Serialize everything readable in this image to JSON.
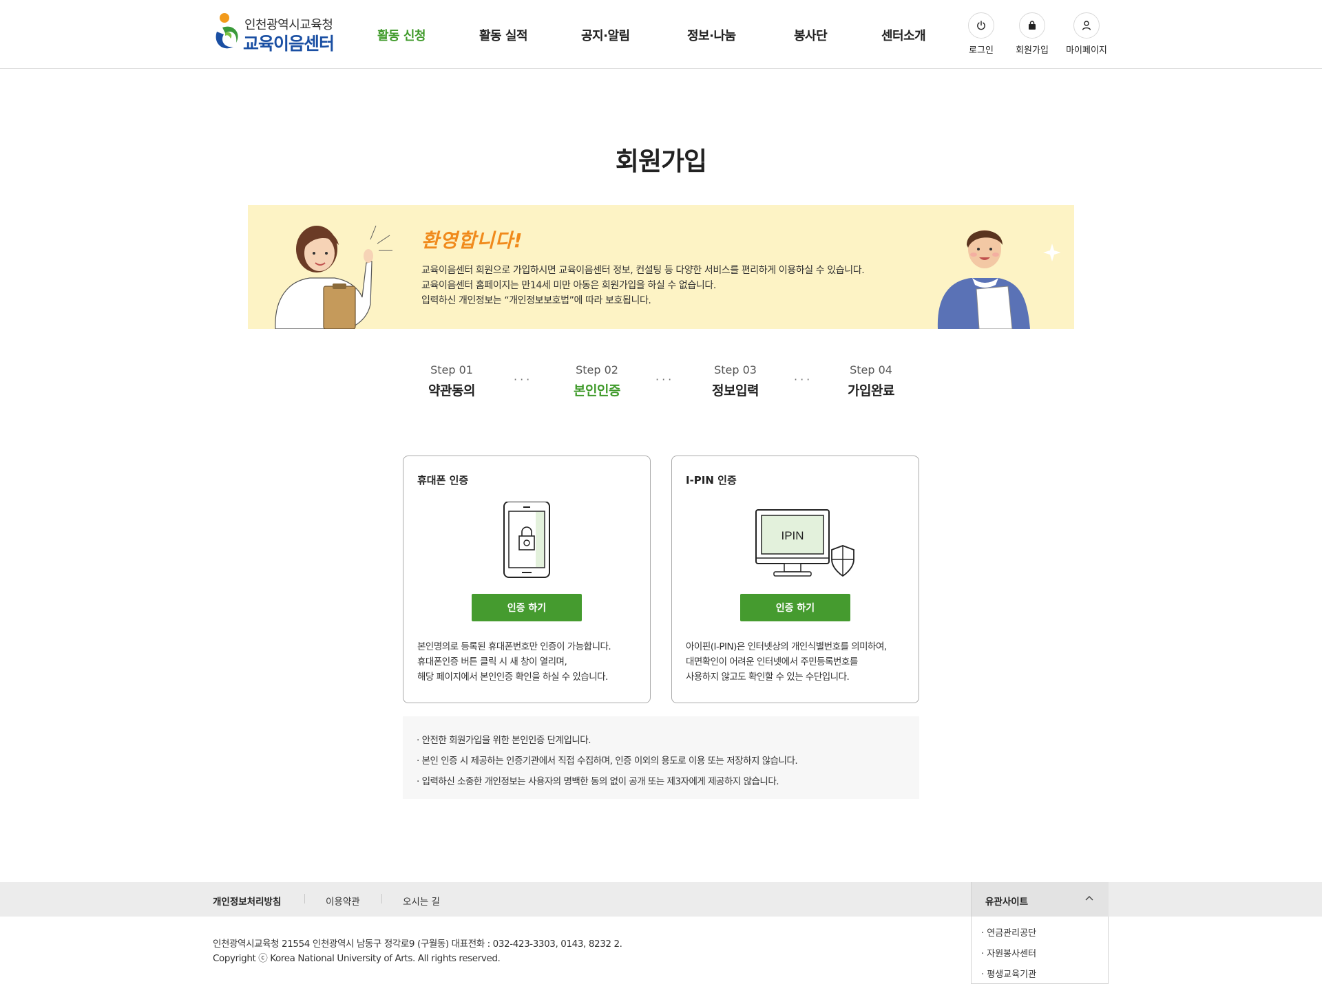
{
  "header": {
    "logo_sub": "인천광역시교육청",
    "logo_main": "교육이음센터",
    "nav": [
      {
        "label": "활동 신청",
        "active": true
      },
      {
        "label": "활동 실적"
      },
      {
        "label": "공지·알림"
      },
      {
        "label": "정보·나눔"
      },
      {
        "label": "봉사단"
      },
      {
        "label": "센터소개"
      }
    ],
    "util": [
      {
        "label": "로그인",
        "icon": "power-icon"
      },
      {
        "label": "회원가입",
        "icon": "lock-bag-icon"
      },
      {
        "label": "마이페이지",
        "icon": "user-icon"
      }
    ]
  },
  "page_title": "회원가입",
  "banner": {
    "welcome": "환영합니다!",
    "lines": [
      "교육이음센터 회원으로 가입하시면 교육이음센터 정보, 컨설팅 등 다양한 서비스를 편리하게 이용하실 수 있습니다.",
      "교육이음센터 홈페이지는 만14세 미만 아동은 회원가입을 하실 수 없습니다.",
      "입력하신 개인정보는 “개인정보보호법”에 따라 보호됩니다."
    ]
  },
  "steps": [
    {
      "num": "Step 01",
      "label": "약관동의"
    },
    {
      "num": "Step 02",
      "label": "본인인증",
      "current": true
    },
    {
      "num": "Step 03",
      "label": "정보입력"
    },
    {
      "num": "Step 04",
      "label": "가입완료"
    }
  ],
  "step_separator": "···",
  "auth": {
    "phone": {
      "title": "휴대폰 인증",
      "button": "인증 하기",
      "desc": [
        "본인명의로 등록된 휴대폰번호만 인증이 가능합니다.",
        "휴대폰인증 버튼 클릭 시 새 창이 열리며,",
        "해당 페이지에서 본인인증 확인을 하실 수 있습니다."
      ]
    },
    "ipin": {
      "title": "I-PIN 인증",
      "screen_text": "IPIN",
      "button": "인증 하기",
      "desc": [
        "아이핀(I-PIN)은 인터넷상의 개인식별번호를 의미하여,",
        "대면확인이 어려운 인터넷에서 주민등록번호를",
        "사용하지 않고도 확인할 수 있는 수단입니다."
      ]
    }
  },
  "notice": [
    "· 안전한 회원가입을 위한 본인인증 단계입니다.",
    "· 본인 인증 시 제공하는 인증기관에서 직접 수집하며, 인증 이외의 용도로 이용 또는 저장하지 않습니다.",
    "· 입력하신 소중한 개인정보는 사용자의 명백한 동의 없이 공개 또는 제3자에게 제공하지 않습니다."
  ],
  "footer": {
    "links": [
      "개인정보처리방침",
      "이용약관",
      "오시는 길"
    ],
    "related_label": "유관사이트",
    "related_sites": [
      "· 연금관리공단",
      "· 자원봉사센터",
      "· 평생교육기관"
    ],
    "address": "인천광역시교육청 21554 인천광역시 남동구 정각로9 (구월동) 대표전화 : 032-423-3303, 0143, 8232 2.",
    "copyright": "Copyright ⓒ Korea National University of Arts. All rights reserved."
  },
  "colors": {
    "accent_green": "#459b2f",
    "active_nav": "#3f9a2a",
    "banner_bg": "#fdf3c5",
    "welcome_orange": "#f08a1c",
    "logo_blue": "#1a4fa3"
  }
}
